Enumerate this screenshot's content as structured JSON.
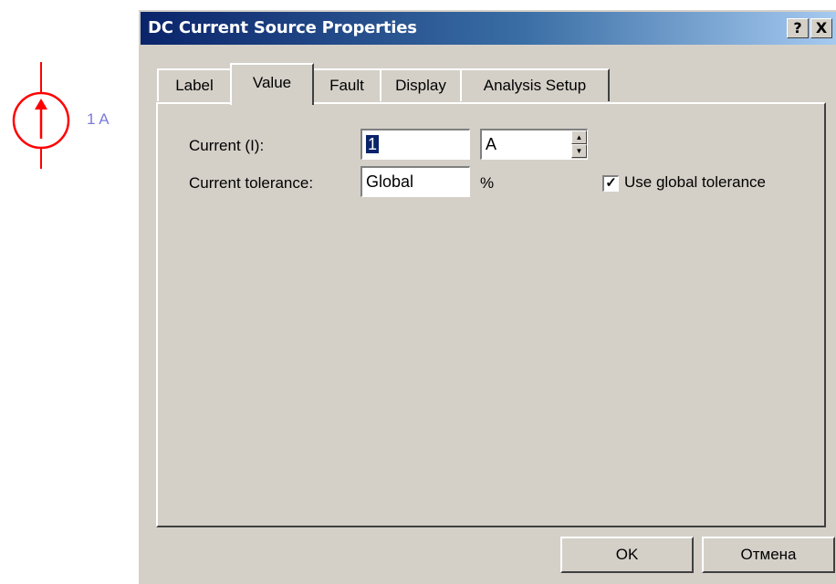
{
  "schematic": {
    "value_label": "1 A",
    "symbol_color": "#ff0000"
  },
  "dialog": {
    "title": "DC Current Source Properties",
    "help_button": "?",
    "close_button": "X"
  },
  "tabs": [
    {
      "label": "Label",
      "active": false
    },
    {
      "label": "Value",
      "active": true
    },
    {
      "label": "Fault",
      "active": false
    },
    {
      "label": "Display",
      "active": false
    },
    {
      "label": "Analysis Setup",
      "active": false
    }
  ],
  "form": {
    "current_label": "Current (I):",
    "current_value": "1",
    "current_unit": "A",
    "tolerance_label": "Current tolerance:",
    "tolerance_value": "Global",
    "tolerance_unit": "%",
    "use_global_label": "Use global tolerance",
    "use_global_checked": true
  },
  "buttons": {
    "ok": "OK",
    "cancel": "Отмена"
  }
}
